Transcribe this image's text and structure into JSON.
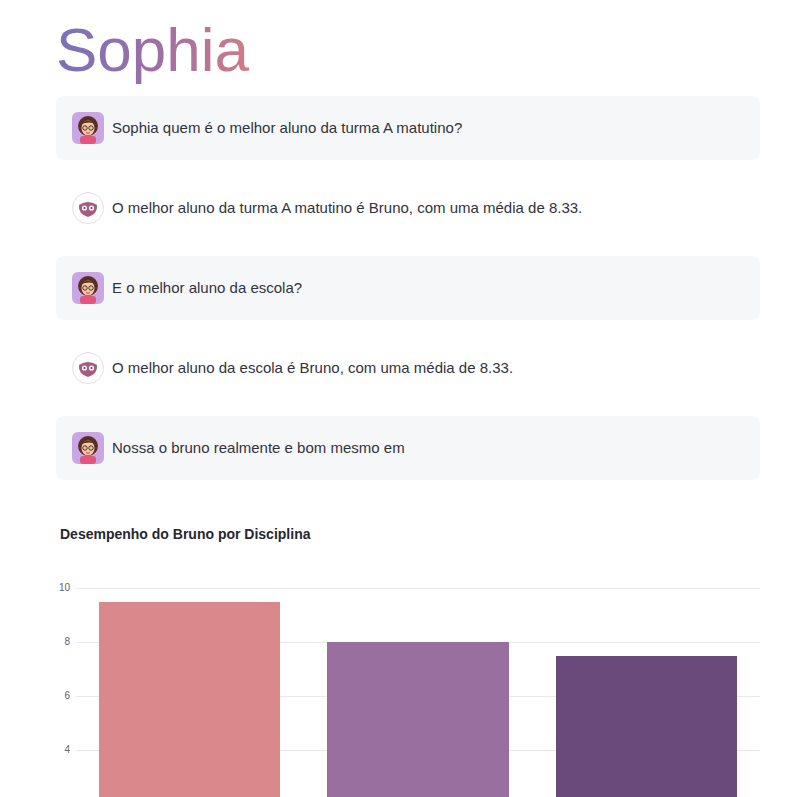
{
  "logo": {
    "text": "Sophia"
  },
  "messages": [
    {
      "kind": "user",
      "text": "Sophia quem é o melhor aluno da turma A matutino?"
    },
    {
      "kind": "assistant",
      "text": "O melhor aluno da turma A matutino é Bruno, com uma média de 8.33."
    },
    {
      "kind": "user",
      "text": "E o melhor aluno da escola?"
    },
    {
      "kind": "assistant",
      "text": "O melhor aluno da escola é Bruno, com uma média de 8.33."
    },
    {
      "kind": "user",
      "text": "Nossa o bruno realmente e bom mesmo em"
    }
  ],
  "chart": {
    "title": "Desempenho do Bruno por Disciplina",
    "y_ticks": [
      "10",
      "8",
      "6",
      "4"
    ],
    "series": [
      {
        "values": [
          9.5,
          8.0,
          7.5
        ],
        "colors": [
          "#d9888c",
          "#996fa0",
          "#6a4a7a"
        ]
      }
    ]
  }
}
